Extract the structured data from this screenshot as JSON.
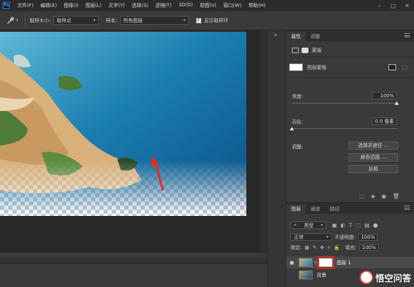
{
  "app": {
    "logo": "Ps"
  },
  "menu": [
    "文件(F)",
    "编辑(E)",
    "图像(I)",
    "图层(L)",
    "文字(Y)",
    "选择(S)",
    "滤镜(T)",
    "3D(D)",
    "视图(V)",
    "窗口(W)",
    "帮助(H)"
  ],
  "window_controls": [
    "–",
    "□",
    "✕"
  ],
  "options": {
    "sample_size_label": "取样大小:",
    "sample_size_value": "取样点",
    "sample_label": "样本:",
    "sample_value": "所有图层",
    "show_ring_label": "显示取样环",
    "show_ring_checked": true
  },
  "properties": {
    "tabs": [
      "属性",
      "调整"
    ],
    "mask_title": "蒙版",
    "layer_mask_label": "图层蒙版",
    "density_label": "浓度:",
    "density_value": "100%",
    "density_level": 1.0,
    "feather_label": "羽化:",
    "feather_value": "0.0 像素",
    "feather_level": 0.0,
    "adjust_label": "调整:",
    "buttons": [
      "选择并遮住 ...",
      "颜色范围 ...",
      "反相"
    ]
  },
  "layers": {
    "tabs": [
      "图层",
      "通道",
      "路径"
    ],
    "filter_value": "类型",
    "blend_mode": "正常",
    "opacity_label": "不透明度:",
    "opacity_value": "100%",
    "lock_label": "锁定:",
    "fill_label": "填充:",
    "fill_value": "100%",
    "rows": [
      {
        "name": "图层 1",
        "selected": true
      },
      {
        "name": "背景",
        "selected": false
      }
    ]
  },
  "watermark": {
    "text": "悟空问答"
  },
  "colors": {
    "accent": "#31a8ff",
    "highlight_box": "#e02020",
    "arrow": "#e62a1e"
  }
}
